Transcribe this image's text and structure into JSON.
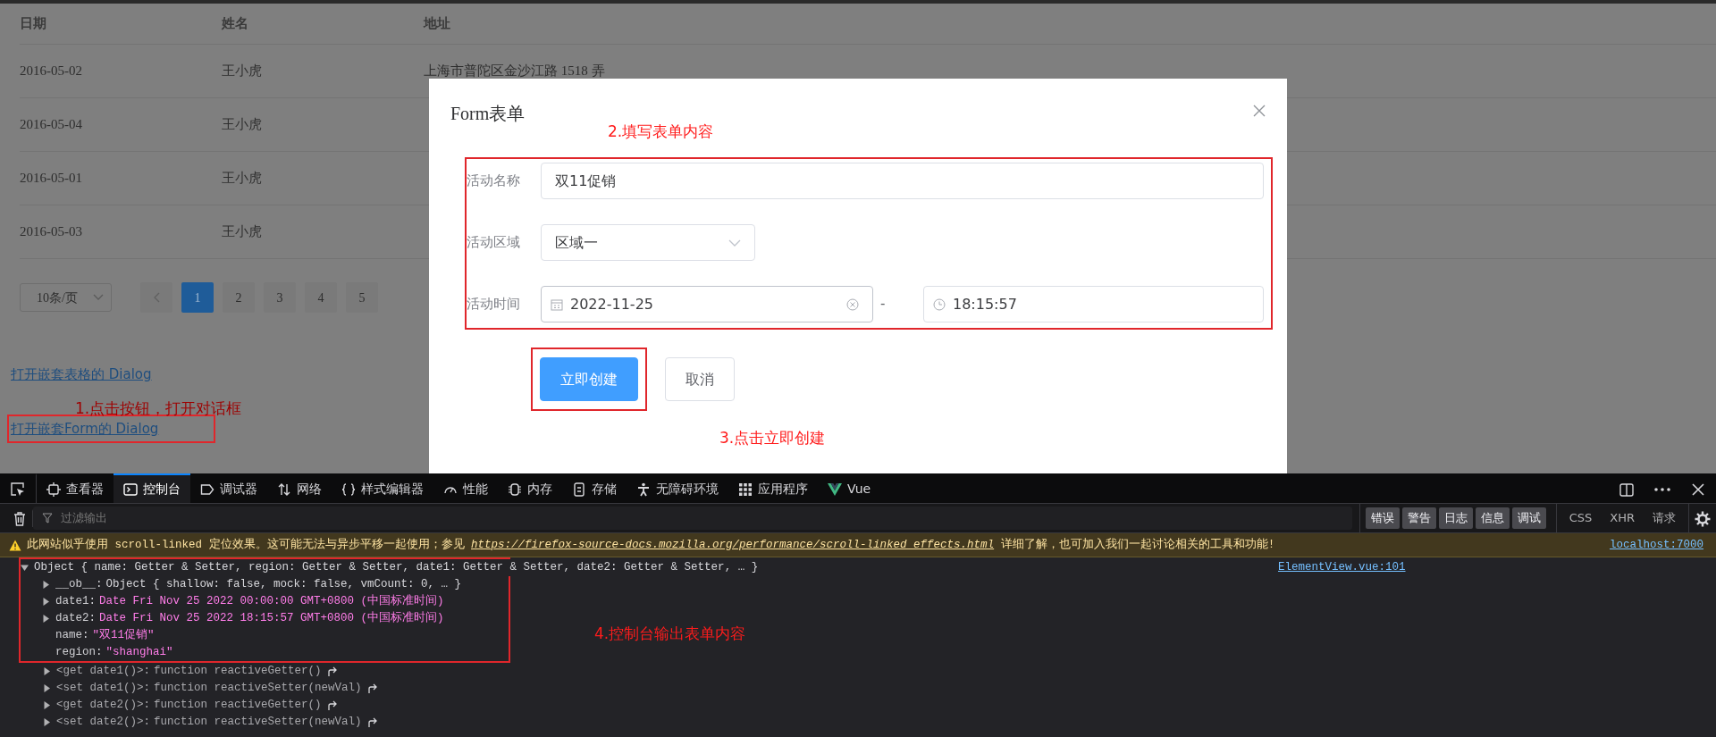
{
  "page": {
    "table": {
      "columns": [
        "日期",
        "姓名",
        "地址"
      ],
      "rows": [
        {
          "date": "2016-05-02",
          "name": "王小虎",
          "address": "上海市普陀区金沙江路 1518 弄"
        },
        {
          "date": "2016-05-04",
          "name": "王小虎"
        },
        {
          "date": "2016-05-01",
          "name": "王小虎"
        },
        {
          "date": "2016-05-03",
          "name": "王小虎"
        }
      ]
    },
    "pagination": {
      "page_size": "10条/页",
      "pages": [
        {
          "label": "1",
          "selected": true
        },
        {
          "label": "2",
          "selected": false
        },
        {
          "label": "3",
          "selected": false
        },
        {
          "label": "4",
          "selected": false
        },
        {
          "label": "5",
          "selected": false
        }
      ]
    },
    "links": [
      {
        "text": "打开嵌套表格的 Dialog",
        "annotated": false
      },
      {
        "text": "打开嵌套Form的 Dialog",
        "annotated": true
      }
    ]
  },
  "dialog": {
    "title": "Form表单",
    "fields": [
      {
        "kind": "text",
        "label": "活动名称",
        "value": "双11促销"
      },
      {
        "kind": "select",
        "label": "活动区域",
        "value": "区域一"
      },
      {
        "kind": "datetime",
        "label": "活动时间",
        "date": "2022-11-25",
        "separator": "-",
        "time": "18:15:57"
      }
    ],
    "buttons": [
      {
        "label": "立即创建",
        "kind": "primary",
        "annotated": true
      },
      {
        "label": "取消",
        "kind": "default",
        "annotated": false
      }
    ]
  },
  "annotations": [
    {
      "text": "1.点击按钮，打开对话框"
    },
    {
      "text": "2.填写表单内容"
    },
    {
      "text": "3.点击立即创建"
    },
    {
      "text": "4.控制台输出表单内容"
    }
  ],
  "devtools": {
    "tabs": [
      {
        "kind": "inspector",
        "label": "查看器",
        "selected": false
      },
      {
        "kind": "console",
        "label": "控制台",
        "selected": true
      },
      {
        "kind": "debugger",
        "label": "调试器",
        "selected": false
      },
      {
        "kind": "network",
        "label": "网络",
        "selected": false
      },
      {
        "kind": "style",
        "label": "样式编辑器",
        "selected": false
      },
      {
        "kind": "performance",
        "label": "性能",
        "selected": false
      },
      {
        "kind": "memory",
        "label": "内存",
        "selected": false
      },
      {
        "kind": "storage",
        "label": "存储",
        "selected": false
      },
      {
        "kind": "accessibility",
        "label": "无障碍环境",
        "selected": false
      },
      {
        "kind": "application",
        "label": "应用程序",
        "selected": false
      },
      {
        "kind": "vue",
        "label": "Vue",
        "selected": false
      }
    ],
    "filter_placeholder": "过滤输出",
    "levels": [
      {
        "label": "错误",
        "selected": true
      },
      {
        "label": "警告",
        "selected": true
      },
      {
        "label": "日志",
        "selected": true
      },
      {
        "label": "信息",
        "selected": true
      },
      {
        "label": "调试",
        "selected": true
      }
    ],
    "filters": [
      {
        "label": "CSS",
        "selected": false
      },
      {
        "label": "XHR",
        "selected": false
      },
      {
        "label": "请求",
        "selected": false
      }
    ],
    "warning": {
      "before": "此网站似乎使用 scroll-linked 定位效果。这可能无法与异步平移一起使用；参见 ",
      "link": "https://firefox-source-docs.mozilla.org/performance/scroll-linked_effects.html",
      "after": " 详细了解，也可加入我们一起讨论相关的工具和功能!",
      "source": "localhost:7000"
    },
    "log": {
      "summary": "Object { name: Getter & Setter, region: Getter & Setter, date1: Getter & Setter, date2: Getter & Setter, … }",
      "expanded": true,
      "source": "ElementView.vue:101",
      "children": [
        {
          "key": "__ob__:",
          "value": "Object { shallow: false, mock: false, vmCount: 0, … }",
          "kind": "object",
          "expanded": false
        },
        {
          "key": "date1:",
          "value": "Date Fri Nov 25 2022 00:00:00 GMT+0800 (中国标准时间)",
          "kind": "date",
          "expanded": false
        },
        {
          "key": "date2:",
          "value": "Date Fri Nov 25 2022 18:15:57 GMT+0800 (中国标准时间)",
          "kind": "date",
          "expanded": false
        },
        {
          "key": "name:",
          "value": "\"双11促销\"",
          "kind": "string",
          "expanded": false
        },
        {
          "key": "region:",
          "value": "\"shanghai\"",
          "kind": "string",
          "expanded": false
        },
        {
          "key": "<get date1()>:",
          "value": "function reactiveGetter()",
          "kind": "accessor",
          "expanded": false
        },
        {
          "key": "<set date1()>:",
          "value": "function reactiveSetter(newVal)",
          "kind": "accessor",
          "expanded": false
        },
        {
          "key": "<get date2()>:",
          "value": "function reactiveGetter()",
          "kind": "accessor",
          "expanded": false
        },
        {
          "key": "<set date2()>:",
          "value": "function reactiveSetter(newVal)",
          "kind": "accessor",
          "expanded": false
        }
      ]
    }
  }
}
